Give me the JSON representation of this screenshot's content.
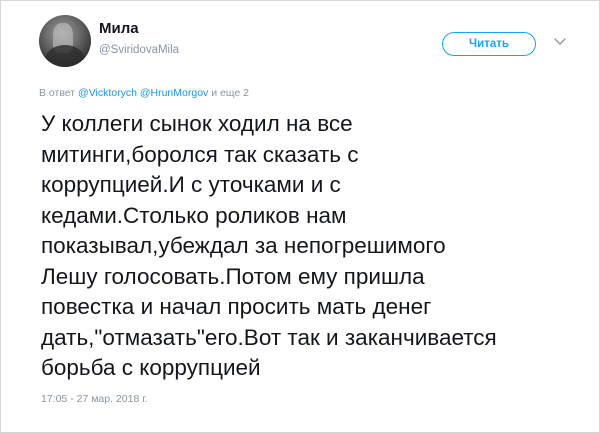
{
  "author": {
    "name": "Мила",
    "handle": "@SviridovaMila"
  },
  "header": {
    "follow_label": "Читать"
  },
  "reply": {
    "prefix": "В ответ",
    "mention1": "@Vicktorych",
    "mention2": "@HrunMorgov",
    "suffix": "и еще 2"
  },
  "tweet": {
    "lines": [
      "У коллеги сынок ходил на все",
      "митинги,боролся так сказать с",
      "коррупцией.И с уточками и с",
      "кедами.Столько роликов нам",
      "показывал,убеждал за непогрешимого",
      "Лешу голосовать.Потом ему пришла",
      "повестка и начал просить мать денег",
      "дать,\"отмазать\"его.Вот так и заканчивается",
      "борьба с коррупцией"
    ],
    "timestamp": "17:05 - 27 мар. 2018 г."
  },
  "icons": {
    "more": "chevron-down-icon"
  },
  "colors": {
    "accent": "#1da1f2",
    "mention": "#1b95e0",
    "muted": "#8a959e",
    "text": "#14171a"
  }
}
